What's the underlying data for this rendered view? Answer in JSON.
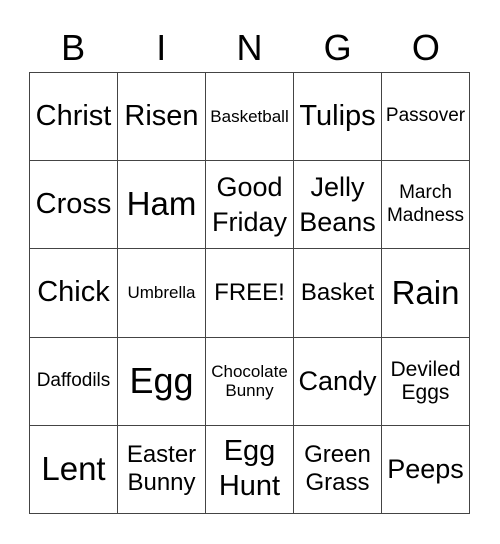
{
  "header": {
    "letters": [
      "B",
      "I",
      "N",
      "G",
      "O"
    ]
  },
  "cells": [
    {
      "text": "Christ",
      "size": "s28"
    },
    {
      "text": "Risen",
      "size": "s28"
    },
    {
      "text": "Basketball",
      "size": "s15"
    },
    {
      "text": "Tulips",
      "size": "s28"
    },
    {
      "text": "Passover",
      "size": "s18"
    },
    {
      "text": "Cross",
      "size": "s28"
    },
    {
      "text": "Ham",
      "size": "s32"
    },
    {
      "text": "Good\nFriday",
      "size": "s25"
    },
    {
      "text": "Jelly\nBeans",
      "size": "s25"
    },
    {
      "text": "March\nMadness",
      "size": "s18"
    },
    {
      "text": "Chick",
      "size": "s28"
    },
    {
      "text": "Umbrella",
      "size": "s15"
    },
    {
      "text": "FREE!",
      "size": "s22"
    },
    {
      "text": "Basket",
      "size": "s22"
    },
    {
      "text": "Rain",
      "size": "s32"
    },
    {
      "text": "Daffodils",
      "size": "s18"
    },
    {
      "text": "Egg",
      "size": "s36"
    },
    {
      "text": "Chocolate\nBunny",
      "size": "s15"
    },
    {
      "text": "Candy",
      "size": "s25"
    },
    {
      "text": "Deviled\nEggs",
      "size": "s20"
    },
    {
      "text": "Lent",
      "size": "s32"
    },
    {
      "text": "Easter\nBunny",
      "size": "s22"
    },
    {
      "text": "Egg\nHunt",
      "size": "s28"
    },
    {
      "text": "Green\nGrass",
      "size": "s22"
    },
    {
      "text": "Peeps",
      "size": "s25"
    }
  ]
}
